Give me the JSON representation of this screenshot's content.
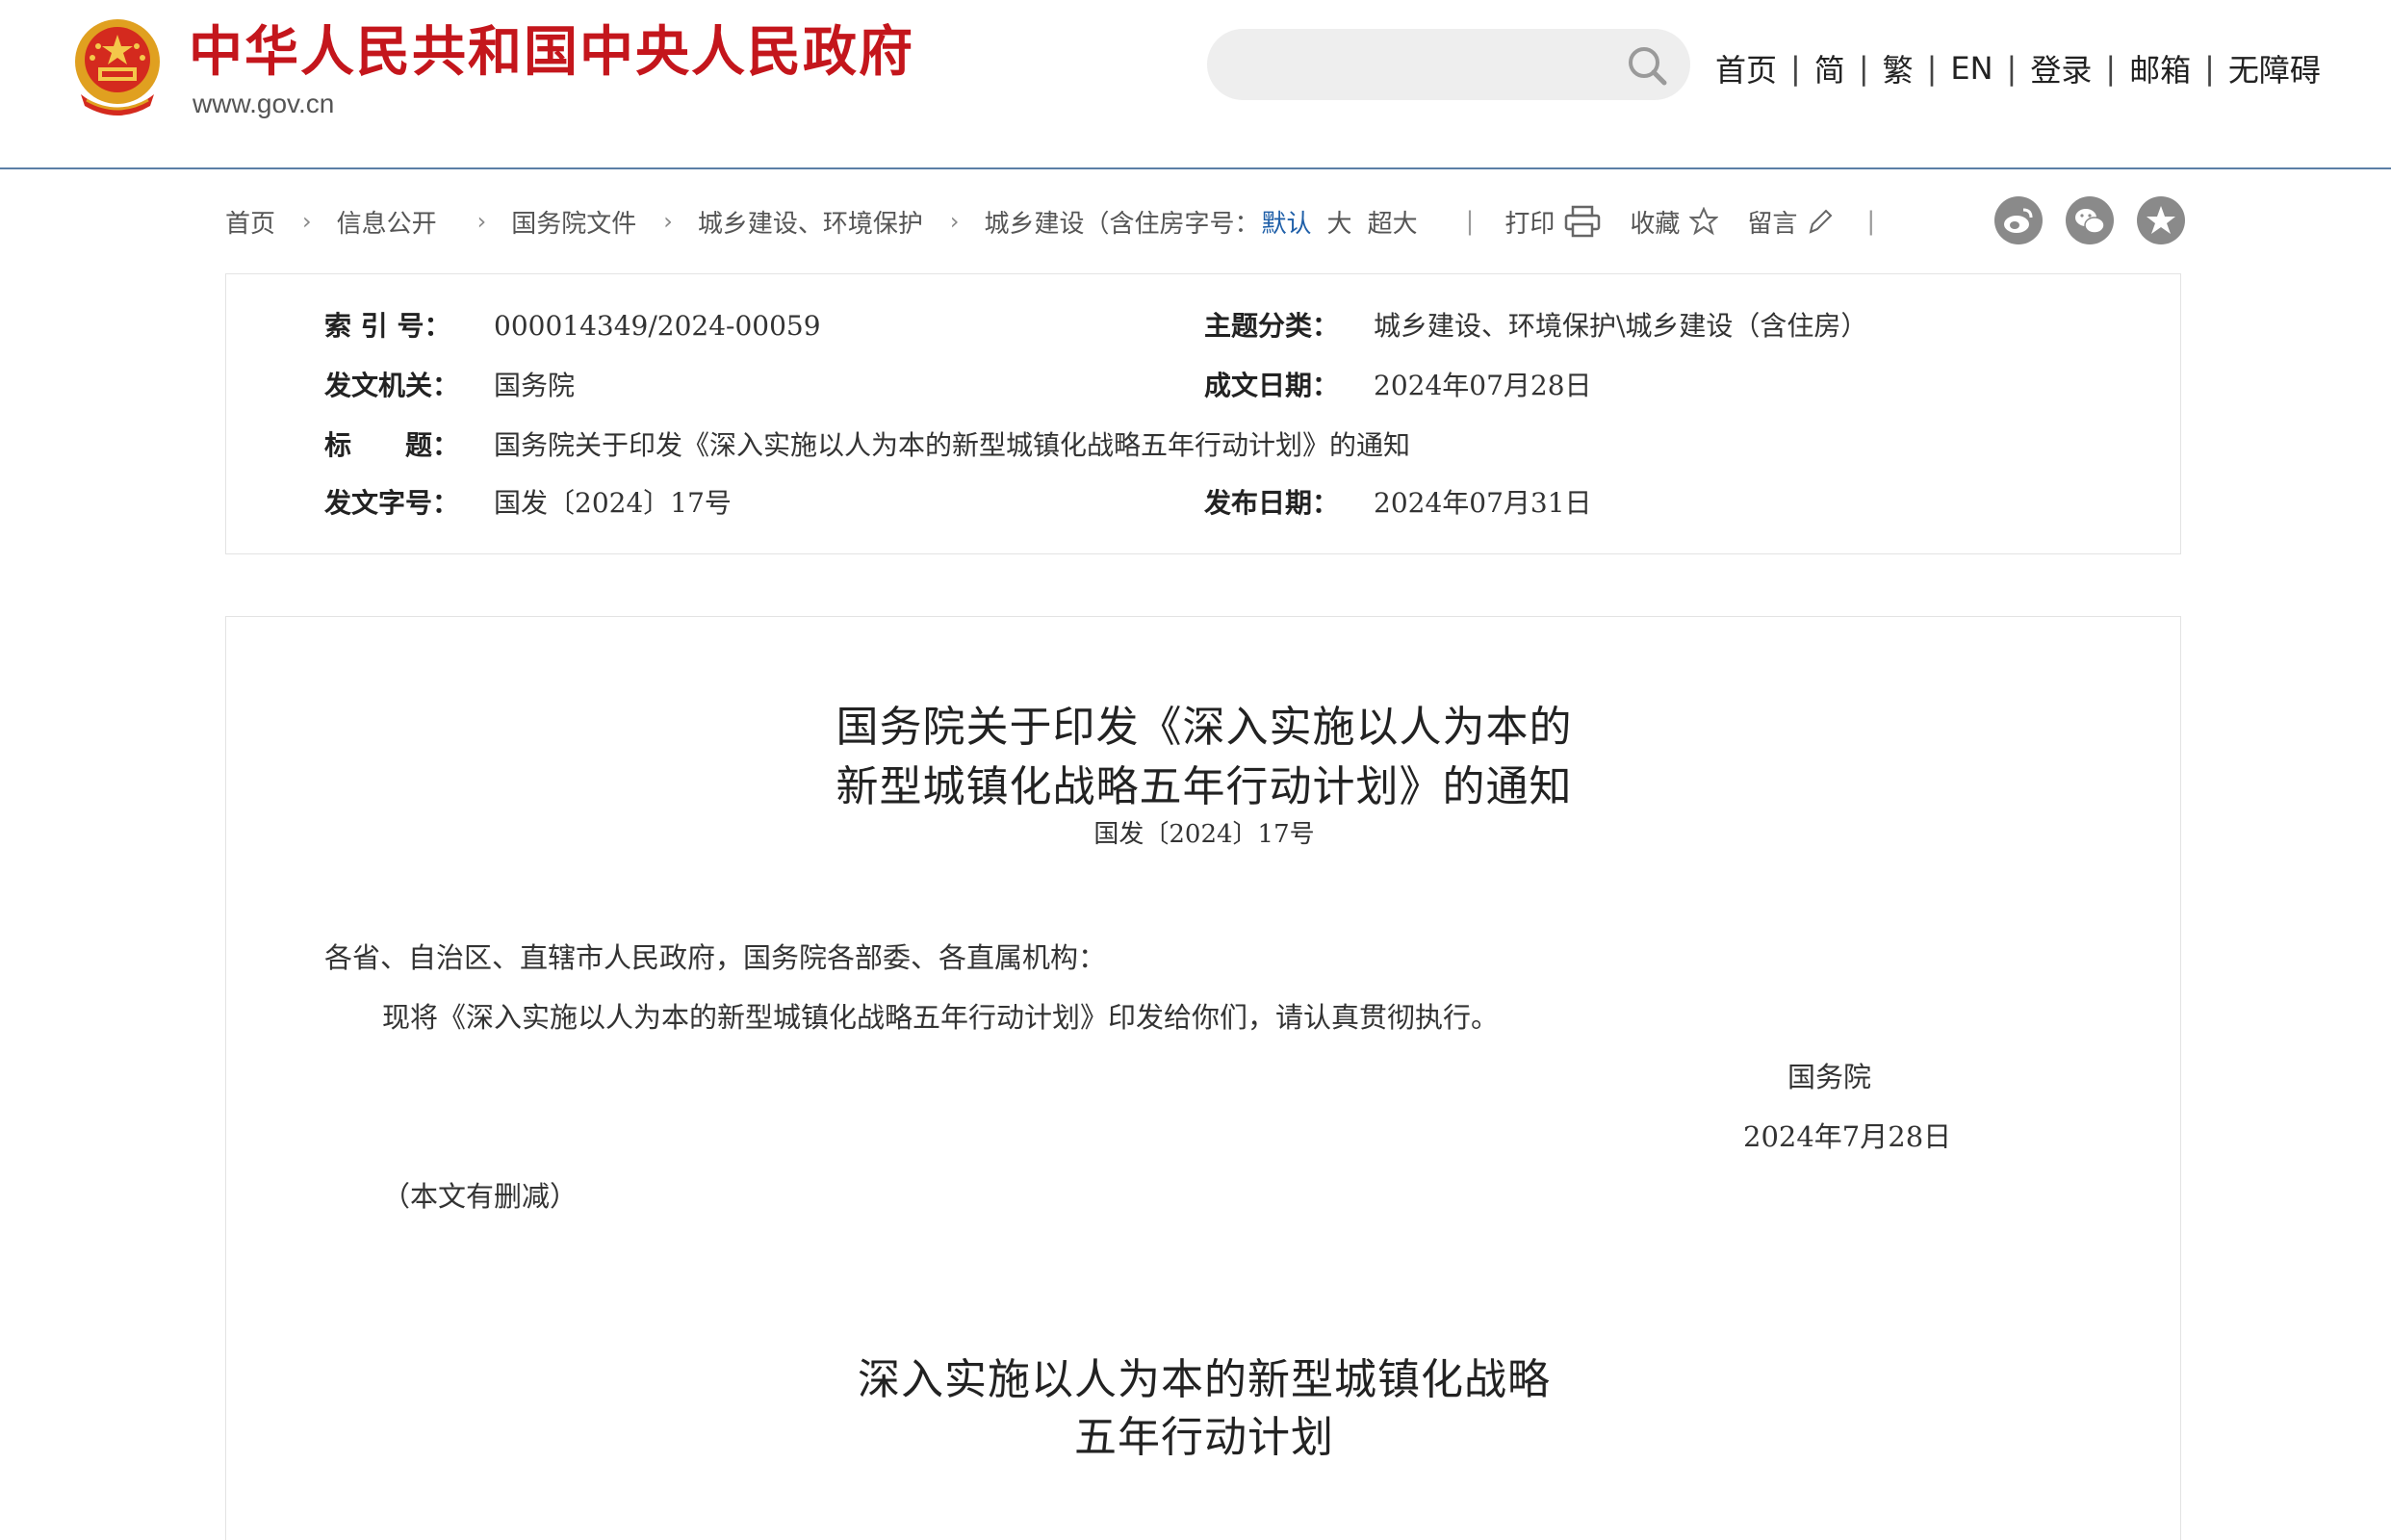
{
  "header": {
    "site_title": "中华人民共和国中央人民政府",
    "site_url": "www.gov.cn",
    "search_placeholder": "",
    "nav": [
      "首页",
      "简",
      "繁",
      "EN",
      "登录",
      "邮箱",
      "无障碍"
    ],
    "nav_separator": "|"
  },
  "colors": {
    "brand_red": "#c4161c",
    "link_blue": "#1f5fa8",
    "header_rule": "#5b7fa6"
  },
  "breadcrumb": {
    "items": [
      "首页",
      "信息公开",
      "国务院文件",
      "城乡建设、环境保护",
      "城乡建设（含住房"
    ],
    "font_size_label": "字号：",
    "font_sizes": [
      "默认",
      "大",
      "超大"
    ],
    "tools": [
      "打印",
      "收藏",
      "留言"
    ],
    "social": [
      "weibo-icon",
      "wechat-icon",
      "qzone-icon"
    ]
  },
  "meta": {
    "index_no": {
      "label": "索 引 号：",
      "value": "000014349/2024-00059"
    },
    "theme": {
      "label": "主题分类：",
      "value": "城乡建设、环境保护\\城乡建设（含住房）"
    },
    "issuer": {
      "label": "发文机关：",
      "value": "国务院"
    },
    "written_date": {
      "label": "成文日期：",
      "value": "2024年07月28日"
    },
    "title": {
      "label": "标　　题：",
      "value": "国务院关于印发《深入实施以人为本的新型城镇化战略五年行动计划》的通知"
    },
    "doc_no": {
      "label": "发文字号：",
      "value": "国发〔2024〕17号"
    },
    "publish_date": {
      "label": "发布日期：",
      "value": "2024年07月31日"
    }
  },
  "document": {
    "title_line1": "国务院关于印发《深入实施以人为本的",
    "title_line2": "新型城镇化战略五年行动计划》的通知",
    "doc_number": "国发〔2024〕17号",
    "salutation": "各省、自治区、直辖市人民政府，国务院各部委、各直属机构：",
    "body": "现将《深入实施以人为本的新型城镇化战略五年行动计划》印发给你们，请认真贯彻执行。",
    "signature": "国务院",
    "sign_date": "2024年7月28日",
    "note": "（本文有删减）",
    "sub_title_line1": "深入实施以人为本的新型城镇化战略",
    "sub_title_line2": "五年行动计划"
  }
}
